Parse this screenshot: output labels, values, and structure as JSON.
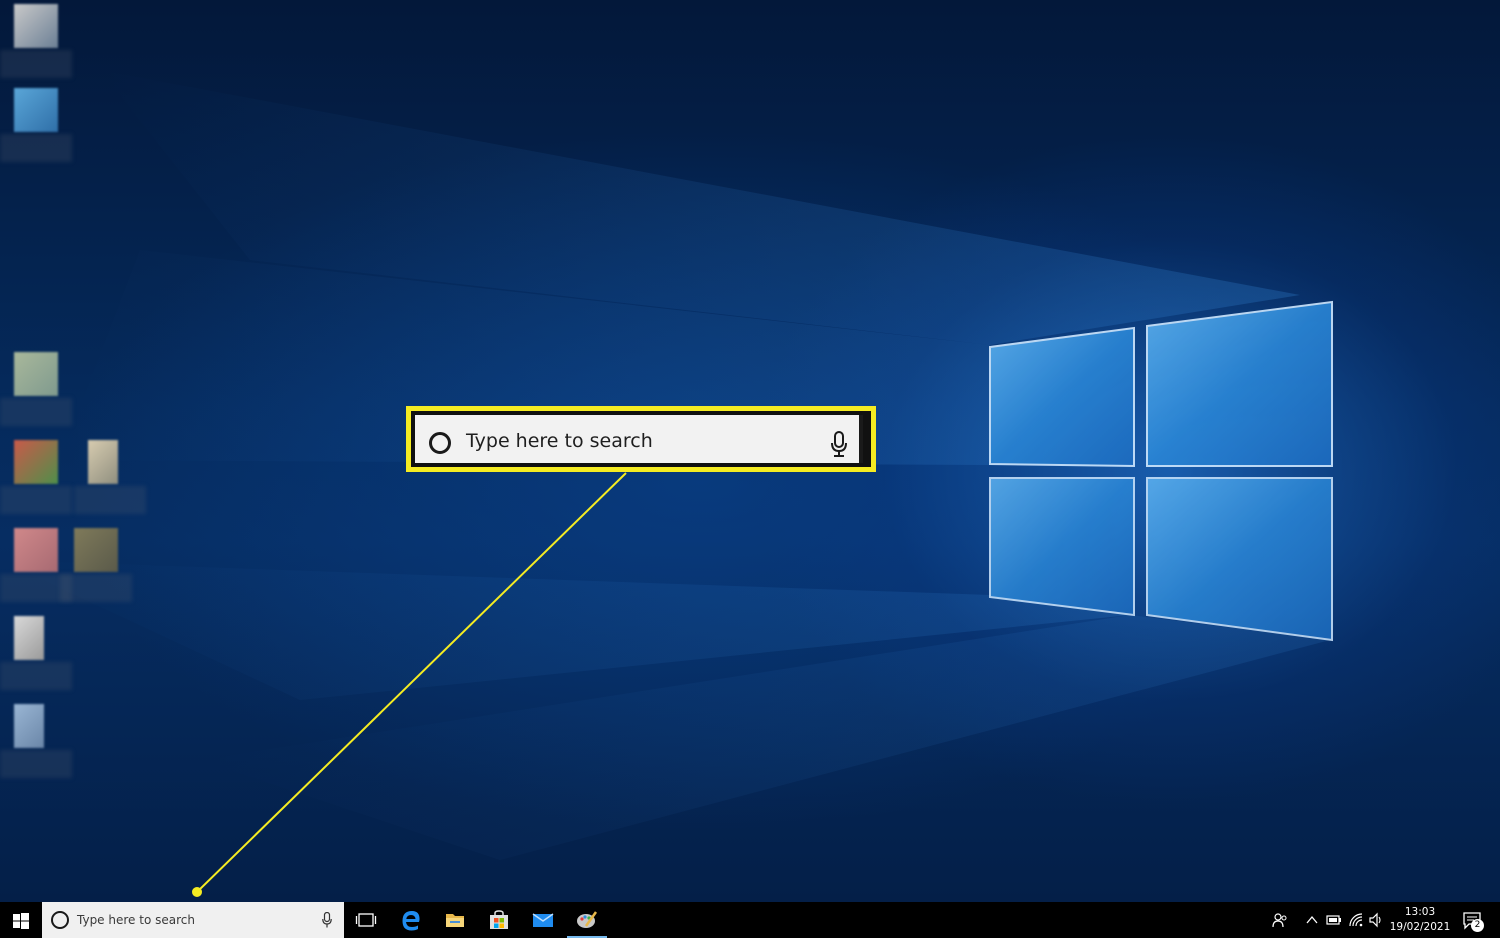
{
  "callout": {
    "search_placeholder": "Type here to search",
    "border_color": "#f5ec22"
  },
  "taskbar": {
    "search_placeholder": "Type here to search",
    "start_icon": "windows-logo-icon",
    "pinned": [
      {
        "name": "task-view-icon"
      },
      {
        "name": "edge-icon"
      },
      {
        "name": "file-explorer-icon"
      },
      {
        "name": "store-icon"
      },
      {
        "name": "mail-icon"
      },
      {
        "name": "paint-icon",
        "active": true
      }
    ],
    "tray": [
      "people-icon",
      "chevron-up-icon",
      "battery-icon",
      "wifi-icon",
      "volume-icon"
    ],
    "clock": {
      "time": "13:03",
      "date": "19/02/2021"
    },
    "notification_count": "2"
  }
}
